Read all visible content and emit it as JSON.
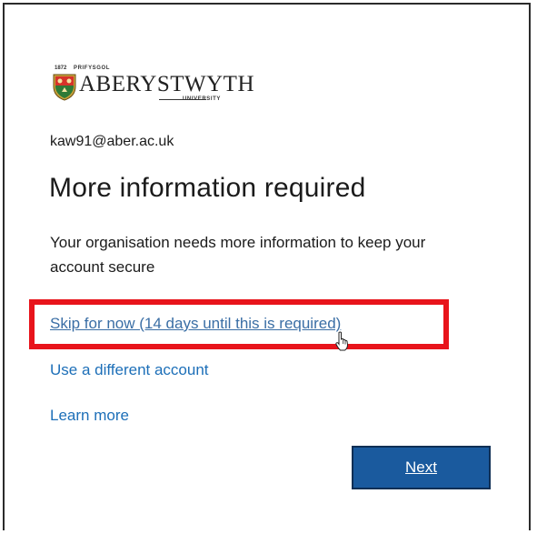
{
  "branding": {
    "year": "1872",
    "prifysgol": "PRIFYSGOL",
    "wordmark": "ABERYSTWYTH",
    "university": "UNIVERSITY",
    "logo_icon": "aberystwyth-crest-icon"
  },
  "account": {
    "email": "kaw91@aber.ac.uk"
  },
  "main": {
    "title": "More information required",
    "description": "Your organisation needs more information to keep your account secure"
  },
  "links": {
    "skip": "Skip for now (14 days until this is required)",
    "different_account": "Use a different account",
    "learn_more": "Learn more"
  },
  "buttons": {
    "next": "Next"
  },
  "colors": {
    "highlight": "#e8141b",
    "link": "#1d6fb8",
    "button": "#1a5a9e"
  }
}
